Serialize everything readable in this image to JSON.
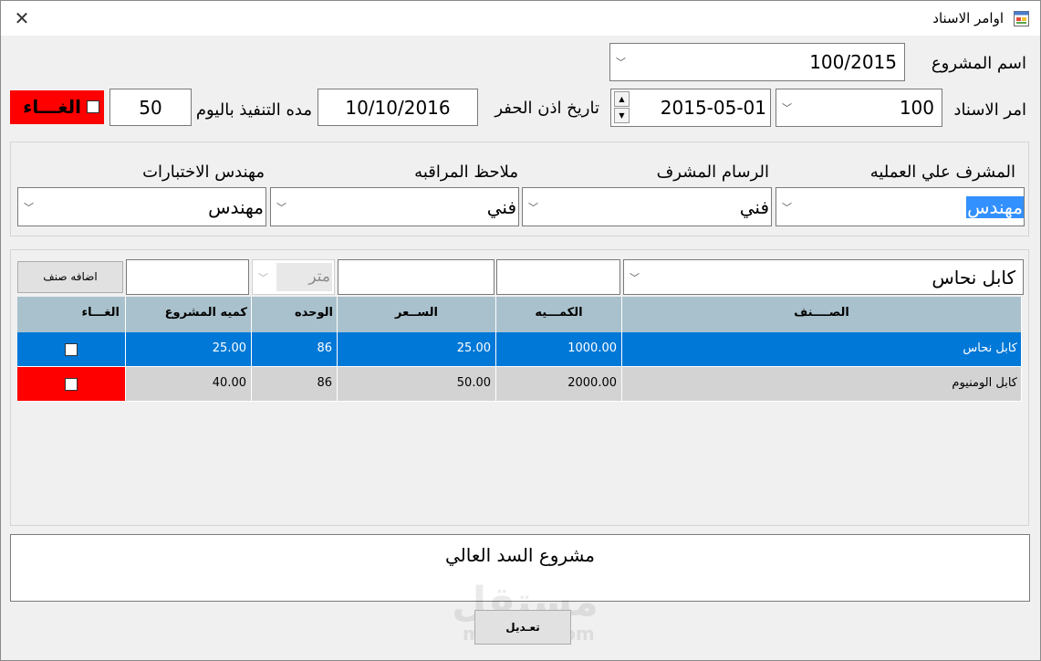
{
  "window": {
    "title": "اوامر الاسناد",
    "close_glyph": "✕",
    "app_icon": "form-icon"
  },
  "project": {
    "label": "اسم المشروع",
    "value": "100/2015"
  },
  "order": {
    "label": "امر الاسناد",
    "value": "100",
    "date_value": "2015-05-01",
    "dig_permit_label": "تاريخ اذن الحفر",
    "dig_permit_value": "10/10/2016",
    "duration_label": "مده التنفيذ باليوم",
    "duration_value": "50",
    "cancel_label": "الغـــاء"
  },
  "staff": {
    "supervisor": {
      "label": "المشرف علي العمليه",
      "value": "مهندس"
    },
    "draftsman": {
      "label": "الرسام المشرف",
      "value": "فني"
    },
    "observer": {
      "label": "ملاحظ المراقبه",
      "value": "فني"
    },
    "test_engineer": {
      "label": "مهندس الاختبارات",
      "value": "مهندس"
    }
  },
  "item_entry": {
    "item_value": "كابل نحاس",
    "quantity_value": "",
    "price_value": "",
    "unit_value": "متر",
    "project_qty_value": "",
    "add_button": "اضافه صنف"
  },
  "table": {
    "headers": {
      "item": "الصــــنف",
      "quantity": "الكمـــيه",
      "price": "الســعر",
      "unit": "الوحده",
      "project_qty": "كميه المشروع",
      "cancel": "الغـــاء"
    },
    "rows": [
      {
        "item": "كابل نحاس",
        "quantity": "1000.00",
        "price": "25.00",
        "unit": "86",
        "project_qty": "25.00"
      },
      {
        "item": "كابل الومنيوم",
        "quantity": "2000.00",
        "price": "50.00",
        "unit": "86",
        "project_qty": "40.00"
      }
    ]
  },
  "notes": {
    "value": "مشروع السد العالي"
  },
  "edit_button": "تعـديل",
  "watermark": {
    "arabic": "مستقل",
    "latin": "mostaql.com"
  },
  "colors": {
    "selected_row": "#0078d7",
    "cancel_red": "#ff0000",
    "header_bg": "#a9c1cc",
    "row_bg": "#d3d3d3",
    "name_highlight": "#3390ff"
  }
}
